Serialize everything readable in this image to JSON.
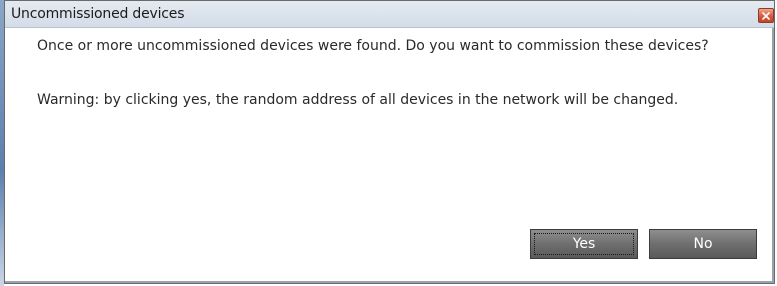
{
  "dialog": {
    "title": "Uncommissioned devices",
    "close_icon": "close-icon",
    "message": "Once or more uncommissioned devices were found. Do you want to commission these devices?",
    "warning": "Warning: by clicking yes, the random address of all devices in the network will be changed.",
    "buttons": {
      "yes_label": "Yes",
      "no_label": "No"
    }
  },
  "colors": {
    "title_bar": "#d9e2ec",
    "button": "#6f6f6f",
    "close_button": "#d65a3c"
  }
}
